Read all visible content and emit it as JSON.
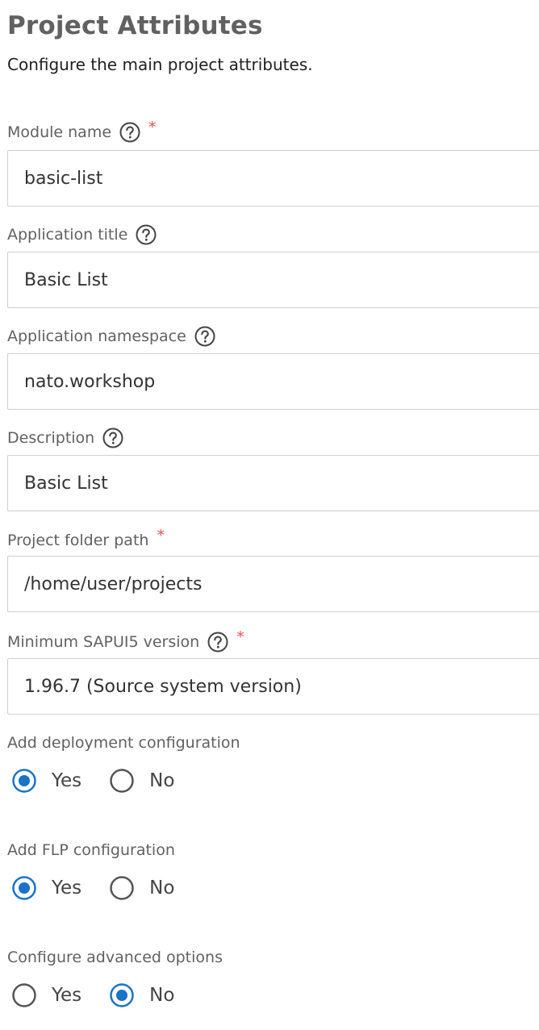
{
  "header": {
    "title": "Project Attributes",
    "subtitle": "Configure the main project attributes."
  },
  "fields": {
    "module_name": {
      "label": "Module name",
      "value": "basic-list",
      "required": true,
      "required_mark": "*",
      "help_icon": "question-circle-icon"
    },
    "application_title": {
      "label": "Application title",
      "value": "Basic List",
      "help_icon": "question-circle-icon"
    },
    "application_namespace": {
      "label": "Application namespace",
      "value": "nato.workshop",
      "help_icon": "question-circle-icon"
    },
    "description": {
      "label": "Description",
      "value": "Basic List",
      "help_icon": "question-circle-icon"
    },
    "project_folder_path": {
      "label": "Project folder path",
      "value": "/home/user/projects",
      "required": true,
      "required_mark": "*"
    },
    "min_sapui5_version": {
      "label": "Minimum SAPUI5 version",
      "value": "1.96.7 (Source system version)",
      "required": true,
      "required_mark": "*",
      "help_icon": "question-circle-icon"
    }
  },
  "radio_groups": {
    "deployment": {
      "label": "Add deployment configuration",
      "yes_label": "Yes",
      "no_label": "No",
      "selected": "Yes"
    },
    "flp": {
      "label": "Add FLP configuration",
      "yes_label": "Yes",
      "no_label": "No",
      "selected": "Yes"
    },
    "advanced": {
      "label": "Configure advanced options",
      "yes_label": "Yes",
      "no_label": "No",
      "selected": "No"
    }
  },
  "colors": {
    "radio_selected": "#1a73c8",
    "radio_unselected": "#555555",
    "required_star": "#e5534b",
    "label_text": "#616161",
    "input_border": "#cfcfcf"
  }
}
